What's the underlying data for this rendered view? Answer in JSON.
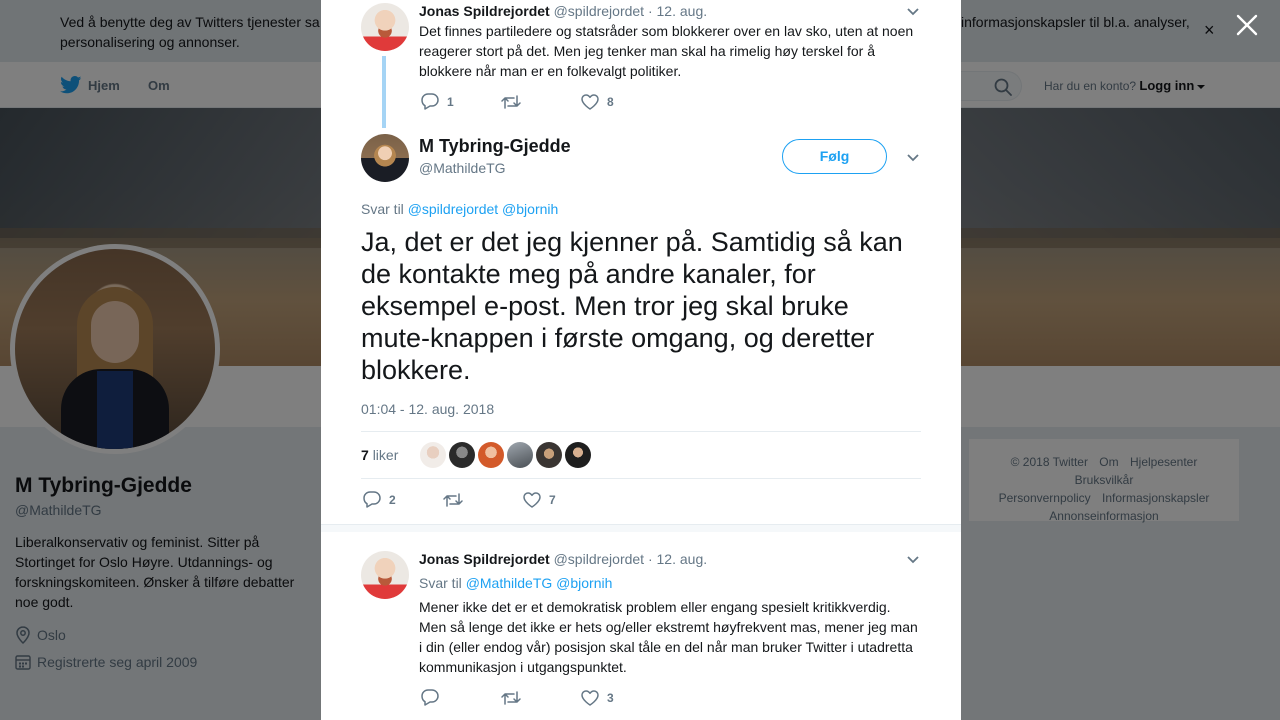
{
  "cookie_banner": {
    "text_left": "Ved å benytte deg av Twitters tjenester sa",
    "text_right": "informasjonskapsler til bl.a. analyser,",
    "text_line2": "personalisering og annonser.",
    "close_glyph": "×"
  },
  "nav": {
    "home": "Hjem",
    "about": "Om",
    "login_prompt": "Har du en konto?",
    "login_link": "Logg inn"
  },
  "profile": {
    "name": "M Tybring-Gjedde",
    "handle": "@MathildeTG",
    "bio": "Liberalkonservativ og feminist. Sitter på Stortinget for Oslo Høyre. Utdannings- og forskningskomiteen. Ønsker å tilføre debatter noe godt.",
    "location": "Oslo",
    "joined": "Registrerte seg april 2009"
  },
  "footer": {
    "links": [
      "© 2018 Twitter",
      "Om",
      "Hjelpesenter",
      "Bruksvilkår",
      "Personvernpolicy",
      "Informasjonskapsler",
      "Annonseinformasjon"
    ]
  },
  "modal": {
    "parent_tweet": {
      "name": "Jonas Spildrejordet",
      "handle": "@spildrejordet",
      "date": "· 12. aug.",
      "text": "Det finnes partiledere og statsråder som blokkerer over en lav sko, uten at noen reagerer stort på det. Men jeg tenker man skal ha rimelig høy terskel for å blokkere når man er en folkevalgt politiker.",
      "replies": "1",
      "retweets": "",
      "likes": "8"
    },
    "main_tweet": {
      "name": "M Tybring-Gjedde",
      "handle": "@MathildeTG",
      "follow_label": "Følg",
      "reply_to_prefix": "Svar til",
      "reply_to_mentions": "@spildrejordet @bjornih",
      "text": "Ja, det er det jeg kjenner på. Samtidig så kan de kontakte meg på andre kanaler, for eksempel e-post. Men tror jeg skal bruke mute-knappen i første omgang, og deretter blokkere.",
      "timestamp": "01:04 - 12. aug. 2018",
      "like_count": "7",
      "like_label": "liker",
      "replies": "2",
      "retweets": "",
      "likes": "7"
    },
    "reply_tweet": {
      "name": "Jonas Spildrejordet",
      "handle": "@spildrejordet",
      "date": "· 12. aug.",
      "reply_to_prefix": "Svar til",
      "reply_to_mentions": "@MathildeTG @bjornih",
      "text": "Mener ikke det er et demokratisk problem eller engang spesielt kritikkverdig. Men så lenge det ikke er hets og/eller ekstremt høyfrekvent mas, mener jeg man i din (eller endog vår) posisjon skal tåle en del når man bruker Twitter i utadretta kommunikasjon i utgangspunktet.",
      "replies": "",
      "retweets": "",
      "likes": "3"
    }
  },
  "colors": {
    "accent": "#1da1f2",
    "text": "#14171a",
    "muted": "#657786",
    "overlay": "rgba(0,0,0,0.5)"
  },
  "icons": [
    "twitter-bird-icon",
    "search-icon",
    "location-icon",
    "calendar-icon",
    "reply-icon",
    "retweet-icon",
    "like-icon",
    "chevron-down-icon",
    "close-icon"
  ]
}
